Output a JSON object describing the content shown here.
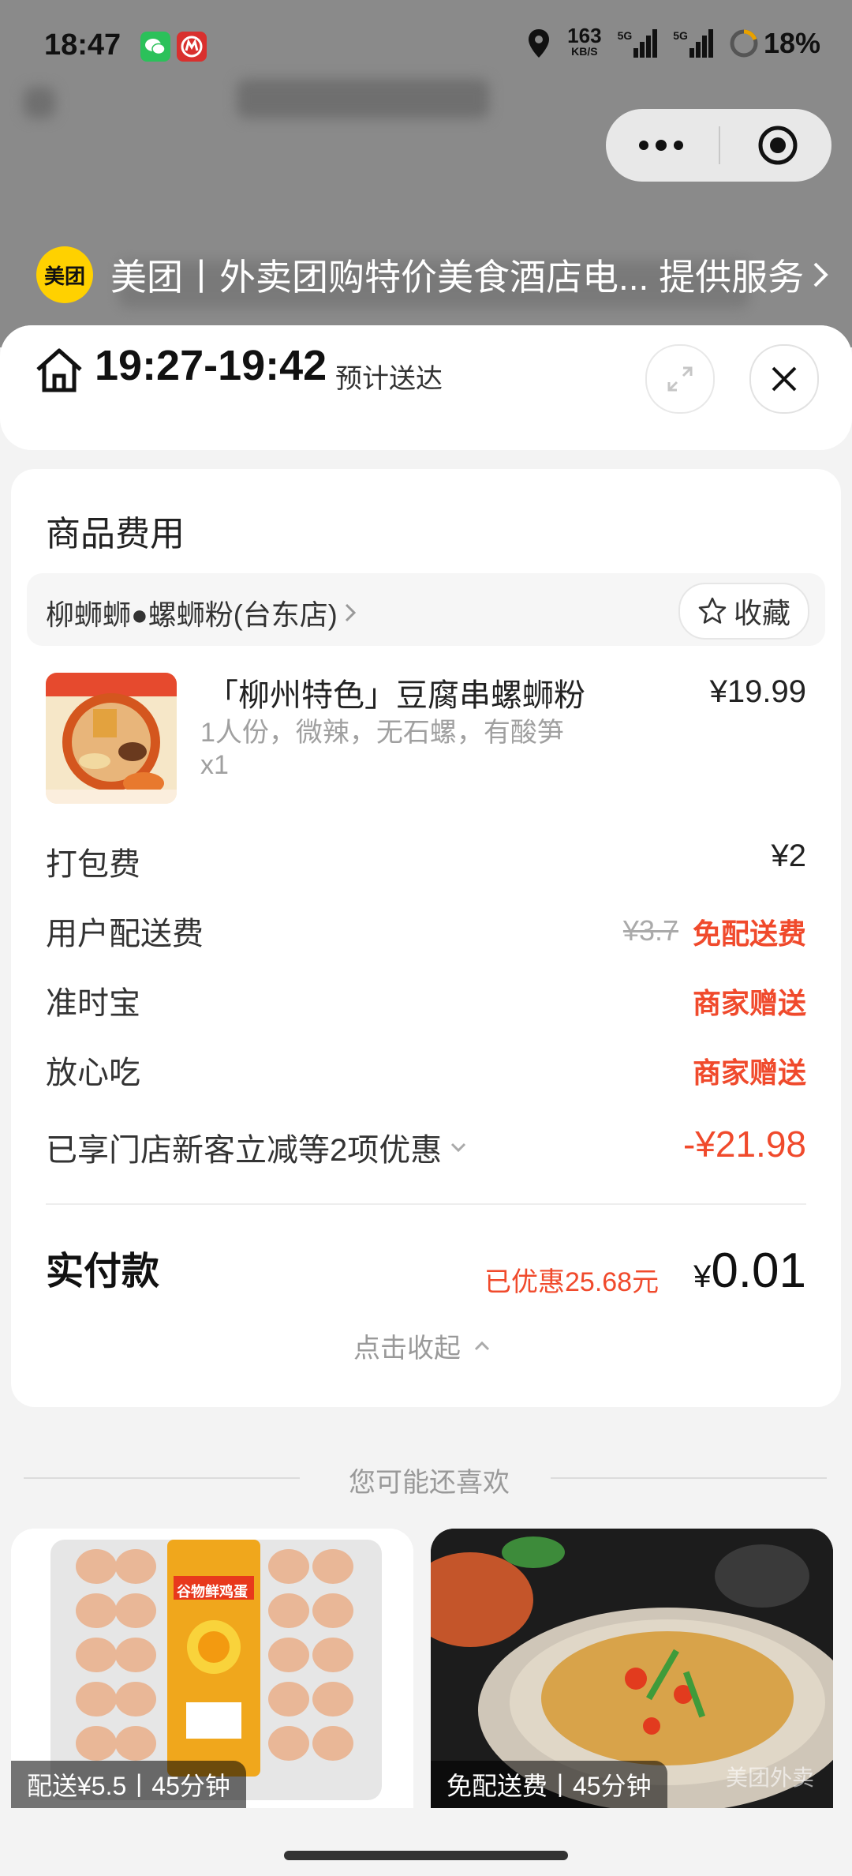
{
  "status_bar": {
    "time": "18:47",
    "net_speed": "163",
    "net_unit": "KB/S",
    "signal1": "5G",
    "signal2": "5G",
    "battery": "18%"
  },
  "mini_program": {
    "provider_logo": "美团",
    "provider_text": "美团丨外卖团购特价美食酒店电... 提供服务"
  },
  "header": {
    "eta_time": "19:27-19:42",
    "eta_label": "预计送达"
  },
  "order": {
    "section_title": "商品费用",
    "store_name": "柳蛳蛳●螺蛳粉(台东店)",
    "favorite_label": "收藏",
    "product": {
      "name": "「柳州特色」豆腐串螺蛳粉",
      "spec": "1人份，微辣，无石螺，有酸笋",
      "quantity": "x1",
      "price": "¥19.99"
    },
    "fees": [
      {
        "label": "打包费",
        "value": "¥2"
      },
      {
        "label": "用户配送费",
        "original": "¥3.7",
        "value": "免配送费"
      },
      {
        "label": "准时宝",
        "value": "商家赠送"
      },
      {
        "label": "放心吃",
        "value": "商家赠送"
      }
    ],
    "discount": {
      "label": "已享门店新客立减等2项优惠",
      "value": "-¥21.98"
    },
    "paid_label": "实付款",
    "saved_text": "已优惠25.68元",
    "paid_currency": "¥",
    "paid_amount": "0.01",
    "collapse_label": "点击收起"
  },
  "recommend": {
    "title": "您可能还喜欢",
    "items": [
      {
        "badge": "配送¥5.5丨45分钟",
        "image_label": "谷物鲜鸡蛋"
      },
      {
        "badge": "免配送费丨45分钟",
        "watermark": "美团外卖"
      }
    ]
  },
  "colors": {
    "accent_red": "#f04a2c",
    "meituan_yellow": "#ffd100"
  }
}
